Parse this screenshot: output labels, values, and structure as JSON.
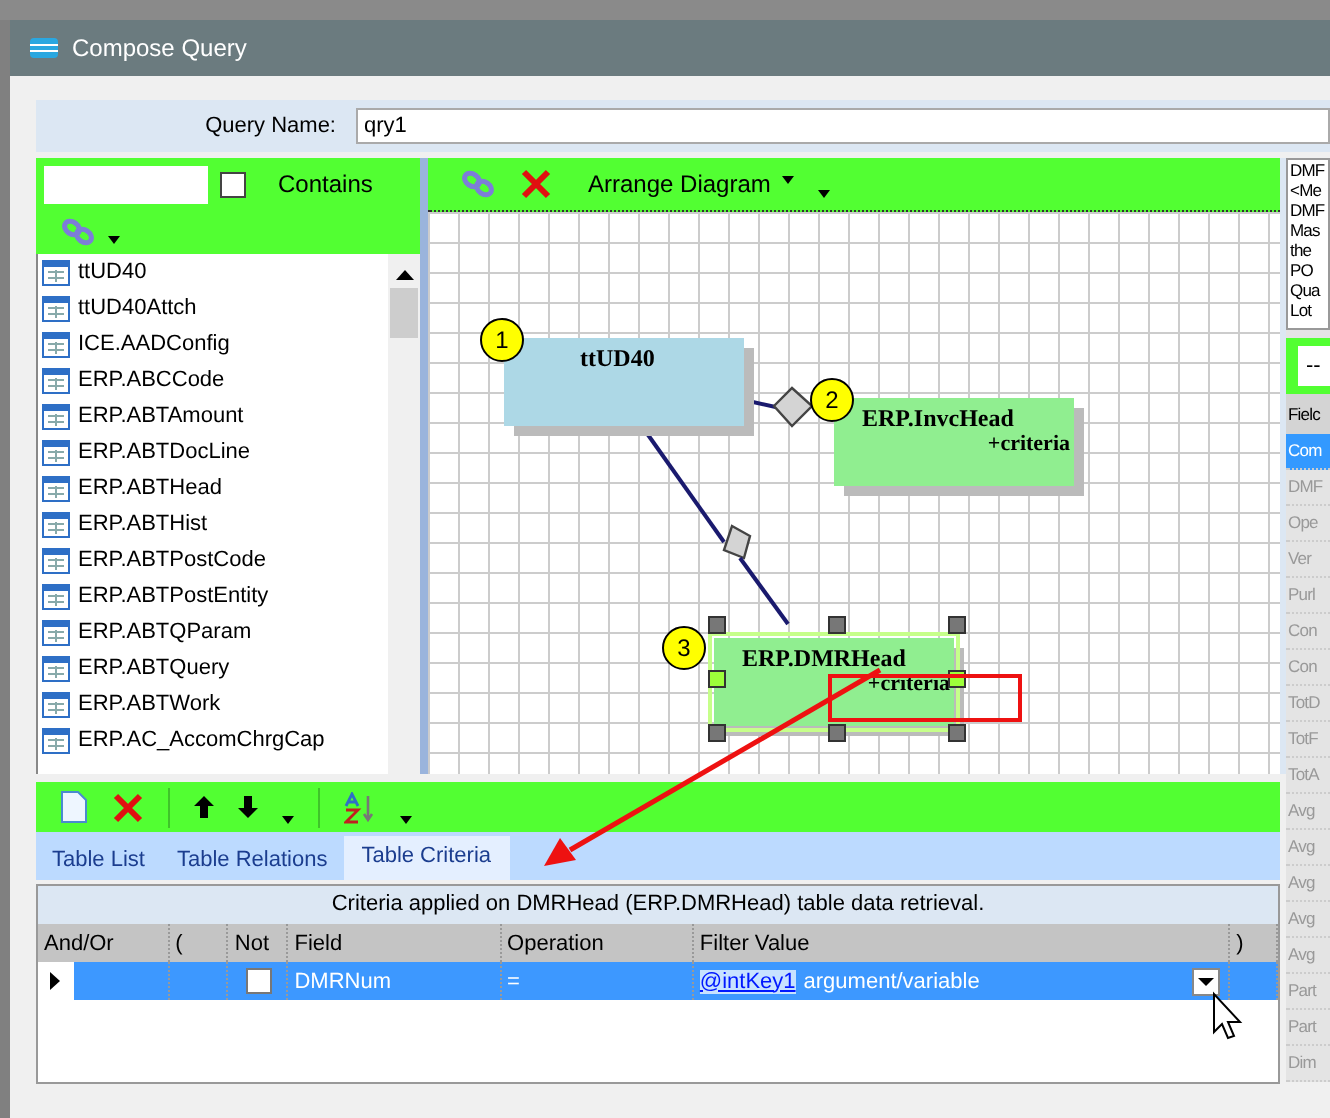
{
  "window": {
    "title": "Compose Query"
  },
  "query_name": {
    "label": "Query Name:",
    "value": "qry1"
  },
  "table_search": {
    "contains_label": "Contains",
    "contains_checked": false
  },
  "tables": [
    "ttUD40",
    "ttUD40Attch",
    "ICE.AADConfig",
    "ERP.ABCCode",
    "ERP.ABTAmount",
    "ERP.ABTDocLine",
    "ERP.ABTHead",
    "ERP.ABTHist",
    "ERP.ABTPostCode",
    "ERP.ABTPostEntity",
    "ERP.ABTQParam",
    "ERP.ABTQuery",
    "ERP.ABTWork",
    "ERP.AC_AccomChrgCap"
  ],
  "diagram_toolbar": {
    "arrange_label": "Arrange Diagram"
  },
  "diagram_nodes": [
    {
      "number": "1",
      "name": "ttUD40",
      "kind": "main",
      "selected": false
    },
    {
      "number": "2",
      "name": "ERP.InvcHead",
      "criteria": "+criteria",
      "kind": "related",
      "selected": false
    },
    {
      "number": "3",
      "name": "ERP.DMRHead",
      "criteria": "+criteria",
      "kind": "related",
      "selected": true
    }
  ],
  "tabs": [
    {
      "label": "Table List",
      "selected": false
    },
    {
      "label": "Table Relations",
      "selected": false
    },
    {
      "label": "Table Criteria",
      "selected": true
    }
  ],
  "criteria_caption": "Criteria applied on DMRHead (ERP.DMRHead)  table data retrieval.",
  "criteria_columns": [
    "And/Or",
    "(",
    "Not",
    "Field",
    "Operation",
    "Filter Value",
    ")"
  ],
  "criteria_rows": [
    {
      "selected": true,
      "and_or": "",
      "open_paren": "",
      "not_checked": false,
      "field": "DMRNum",
      "operation": "=",
      "filter_link": "@intKey1",
      "filter_text": "argument/variable",
      "close_paren": ""
    }
  ],
  "right_panel": {
    "description_lines": [
      "DMF",
      "<Me",
      "DMF",
      "Mas",
      "the",
      "PO",
      "Qua",
      "Lot"
    ],
    "filter_value": "--",
    "fields_header": "Fielc",
    "fields": [
      {
        "label": "Com",
        "selected": true
      },
      {
        "label": "DMF",
        "selected": false
      },
      {
        "label": "Ope",
        "selected": false
      },
      {
        "label": "Ver",
        "selected": false
      },
      {
        "label": "Purl",
        "selected": false
      },
      {
        "label": "Con",
        "selected": false
      },
      {
        "label": "Con",
        "selected": false
      },
      {
        "label": "TotD",
        "selected": false
      },
      {
        "label": "TotF",
        "selected": false
      },
      {
        "label": "TotA",
        "selected": false
      },
      {
        "label": "Avg",
        "selected": false
      },
      {
        "label": "Avg",
        "selected": false
      },
      {
        "label": "Avg",
        "selected": false
      },
      {
        "label": "Avg",
        "selected": false
      },
      {
        "label": "Avg",
        "selected": false
      },
      {
        "label": "Part",
        "selected": false
      },
      {
        "label": "Part",
        "selected": false
      },
      {
        "label": "Dim",
        "selected": false
      }
    ]
  }
}
